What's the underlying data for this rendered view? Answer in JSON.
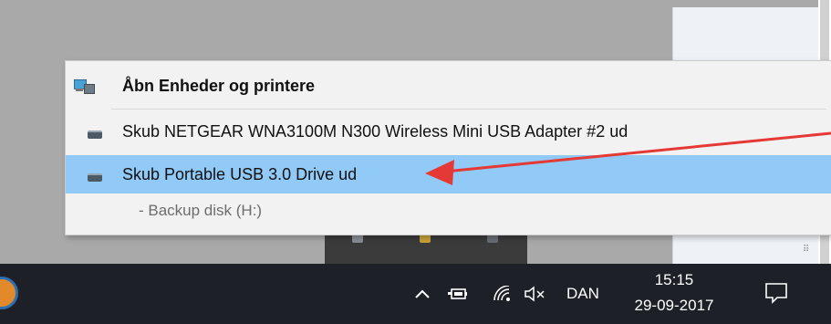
{
  "menu": {
    "open_devices": "Åbn Enheder og printere",
    "eject_netgear": "Skub NETGEAR WNA3100M N300 Wireless Mini USB Adapter #2 ud",
    "eject_portable": "Skub Portable USB 3.0 Drive ud",
    "sub_backup": "-   Backup disk (H:)",
    "highlight_color": "#91c9f7"
  },
  "taskbar": {
    "chevron": "^",
    "language": "DAN",
    "time": "15:15",
    "date": "29-09-2017",
    "icons": [
      "show-hidden-icons",
      "power-icon",
      "wifi-icon",
      "volume-muted-icon",
      "action-center-icon"
    ]
  },
  "annotation": {
    "arrow_color": "#e53935"
  }
}
